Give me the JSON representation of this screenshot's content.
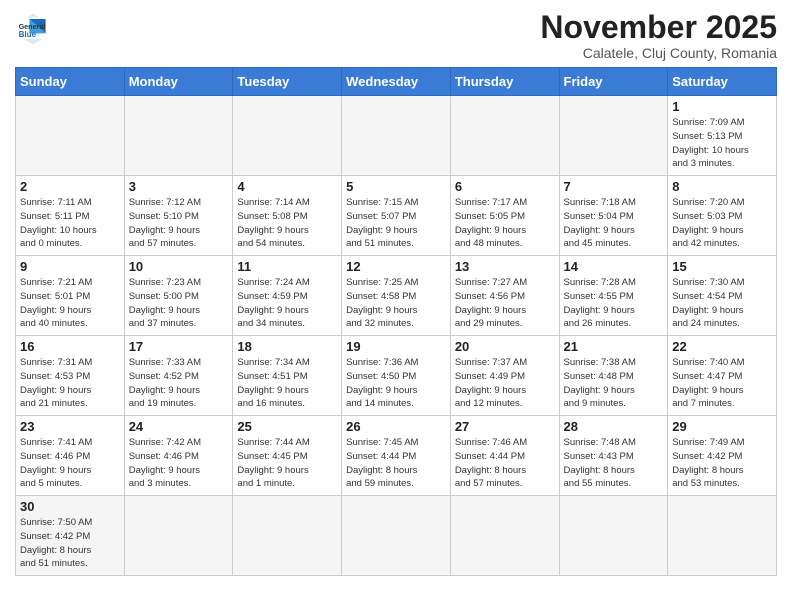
{
  "logo": {
    "general": "General",
    "blue": "Blue"
  },
  "header": {
    "month_title": "November 2025",
    "subtitle": "Calatele, Cluj County, Romania"
  },
  "weekdays": [
    "Sunday",
    "Monday",
    "Tuesday",
    "Wednesday",
    "Thursday",
    "Friday",
    "Saturday"
  ],
  "weeks": [
    [
      {
        "day": "",
        "info": "",
        "empty": true
      },
      {
        "day": "",
        "info": "",
        "empty": true
      },
      {
        "day": "",
        "info": "",
        "empty": true
      },
      {
        "day": "",
        "info": "",
        "empty": true
      },
      {
        "day": "",
        "info": "",
        "empty": true
      },
      {
        "day": "",
        "info": "",
        "empty": true
      },
      {
        "day": "1",
        "info": "Sunrise: 7:09 AM\nSunset: 5:13 PM\nDaylight: 10 hours\nand 3 minutes."
      }
    ],
    [
      {
        "day": "2",
        "info": "Sunrise: 7:11 AM\nSunset: 5:11 PM\nDaylight: 10 hours\nand 0 minutes."
      },
      {
        "day": "3",
        "info": "Sunrise: 7:12 AM\nSunset: 5:10 PM\nDaylight: 9 hours\nand 57 minutes."
      },
      {
        "day": "4",
        "info": "Sunrise: 7:14 AM\nSunset: 5:08 PM\nDaylight: 9 hours\nand 54 minutes."
      },
      {
        "day": "5",
        "info": "Sunrise: 7:15 AM\nSunset: 5:07 PM\nDaylight: 9 hours\nand 51 minutes."
      },
      {
        "day": "6",
        "info": "Sunrise: 7:17 AM\nSunset: 5:05 PM\nDaylight: 9 hours\nand 48 minutes."
      },
      {
        "day": "7",
        "info": "Sunrise: 7:18 AM\nSunset: 5:04 PM\nDaylight: 9 hours\nand 45 minutes."
      },
      {
        "day": "8",
        "info": "Sunrise: 7:20 AM\nSunset: 5:03 PM\nDaylight: 9 hours\nand 42 minutes."
      }
    ],
    [
      {
        "day": "9",
        "info": "Sunrise: 7:21 AM\nSunset: 5:01 PM\nDaylight: 9 hours\nand 40 minutes."
      },
      {
        "day": "10",
        "info": "Sunrise: 7:23 AM\nSunset: 5:00 PM\nDaylight: 9 hours\nand 37 minutes."
      },
      {
        "day": "11",
        "info": "Sunrise: 7:24 AM\nSunset: 4:59 PM\nDaylight: 9 hours\nand 34 minutes."
      },
      {
        "day": "12",
        "info": "Sunrise: 7:25 AM\nSunset: 4:58 PM\nDaylight: 9 hours\nand 32 minutes."
      },
      {
        "day": "13",
        "info": "Sunrise: 7:27 AM\nSunset: 4:56 PM\nDaylight: 9 hours\nand 29 minutes."
      },
      {
        "day": "14",
        "info": "Sunrise: 7:28 AM\nSunset: 4:55 PM\nDaylight: 9 hours\nand 26 minutes."
      },
      {
        "day": "15",
        "info": "Sunrise: 7:30 AM\nSunset: 4:54 PM\nDaylight: 9 hours\nand 24 minutes."
      }
    ],
    [
      {
        "day": "16",
        "info": "Sunrise: 7:31 AM\nSunset: 4:53 PM\nDaylight: 9 hours\nand 21 minutes."
      },
      {
        "day": "17",
        "info": "Sunrise: 7:33 AM\nSunset: 4:52 PM\nDaylight: 9 hours\nand 19 minutes."
      },
      {
        "day": "18",
        "info": "Sunrise: 7:34 AM\nSunset: 4:51 PM\nDaylight: 9 hours\nand 16 minutes."
      },
      {
        "day": "19",
        "info": "Sunrise: 7:36 AM\nSunset: 4:50 PM\nDaylight: 9 hours\nand 14 minutes."
      },
      {
        "day": "20",
        "info": "Sunrise: 7:37 AM\nSunset: 4:49 PM\nDaylight: 9 hours\nand 12 minutes."
      },
      {
        "day": "21",
        "info": "Sunrise: 7:38 AM\nSunset: 4:48 PM\nDaylight: 9 hours\nand 9 minutes."
      },
      {
        "day": "22",
        "info": "Sunrise: 7:40 AM\nSunset: 4:47 PM\nDaylight: 9 hours\nand 7 minutes."
      }
    ],
    [
      {
        "day": "23",
        "info": "Sunrise: 7:41 AM\nSunset: 4:46 PM\nDaylight: 9 hours\nand 5 minutes."
      },
      {
        "day": "24",
        "info": "Sunrise: 7:42 AM\nSunset: 4:46 PM\nDaylight: 9 hours\nand 3 minutes."
      },
      {
        "day": "25",
        "info": "Sunrise: 7:44 AM\nSunset: 4:45 PM\nDaylight: 9 hours\nand 1 minute."
      },
      {
        "day": "26",
        "info": "Sunrise: 7:45 AM\nSunset: 4:44 PM\nDaylight: 8 hours\nand 59 minutes."
      },
      {
        "day": "27",
        "info": "Sunrise: 7:46 AM\nSunset: 4:44 PM\nDaylight: 8 hours\nand 57 minutes."
      },
      {
        "day": "28",
        "info": "Sunrise: 7:48 AM\nSunset: 4:43 PM\nDaylight: 8 hours\nand 55 minutes."
      },
      {
        "day": "29",
        "info": "Sunrise: 7:49 AM\nSunset: 4:42 PM\nDaylight: 8 hours\nand 53 minutes."
      }
    ],
    [
      {
        "day": "30",
        "info": "Sunrise: 7:50 AM\nSunset: 4:42 PM\nDaylight: 8 hours\nand 51 minutes.",
        "last": true
      },
      {
        "day": "",
        "info": "",
        "empty": true,
        "last": true
      },
      {
        "day": "",
        "info": "",
        "empty": true,
        "last": true
      },
      {
        "day": "",
        "info": "",
        "empty": true,
        "last": true
      },
      {
        "day": "",
        "info": "",
        "empty": true,
        "last": true
      },
      {
        "day": "",
        "info": "",
        "empty": true,
        "last": true
      },
      {
        "day": "",
        "info": "",
        "empty": true,
        "last": true
      }
    ]
  ]
}
